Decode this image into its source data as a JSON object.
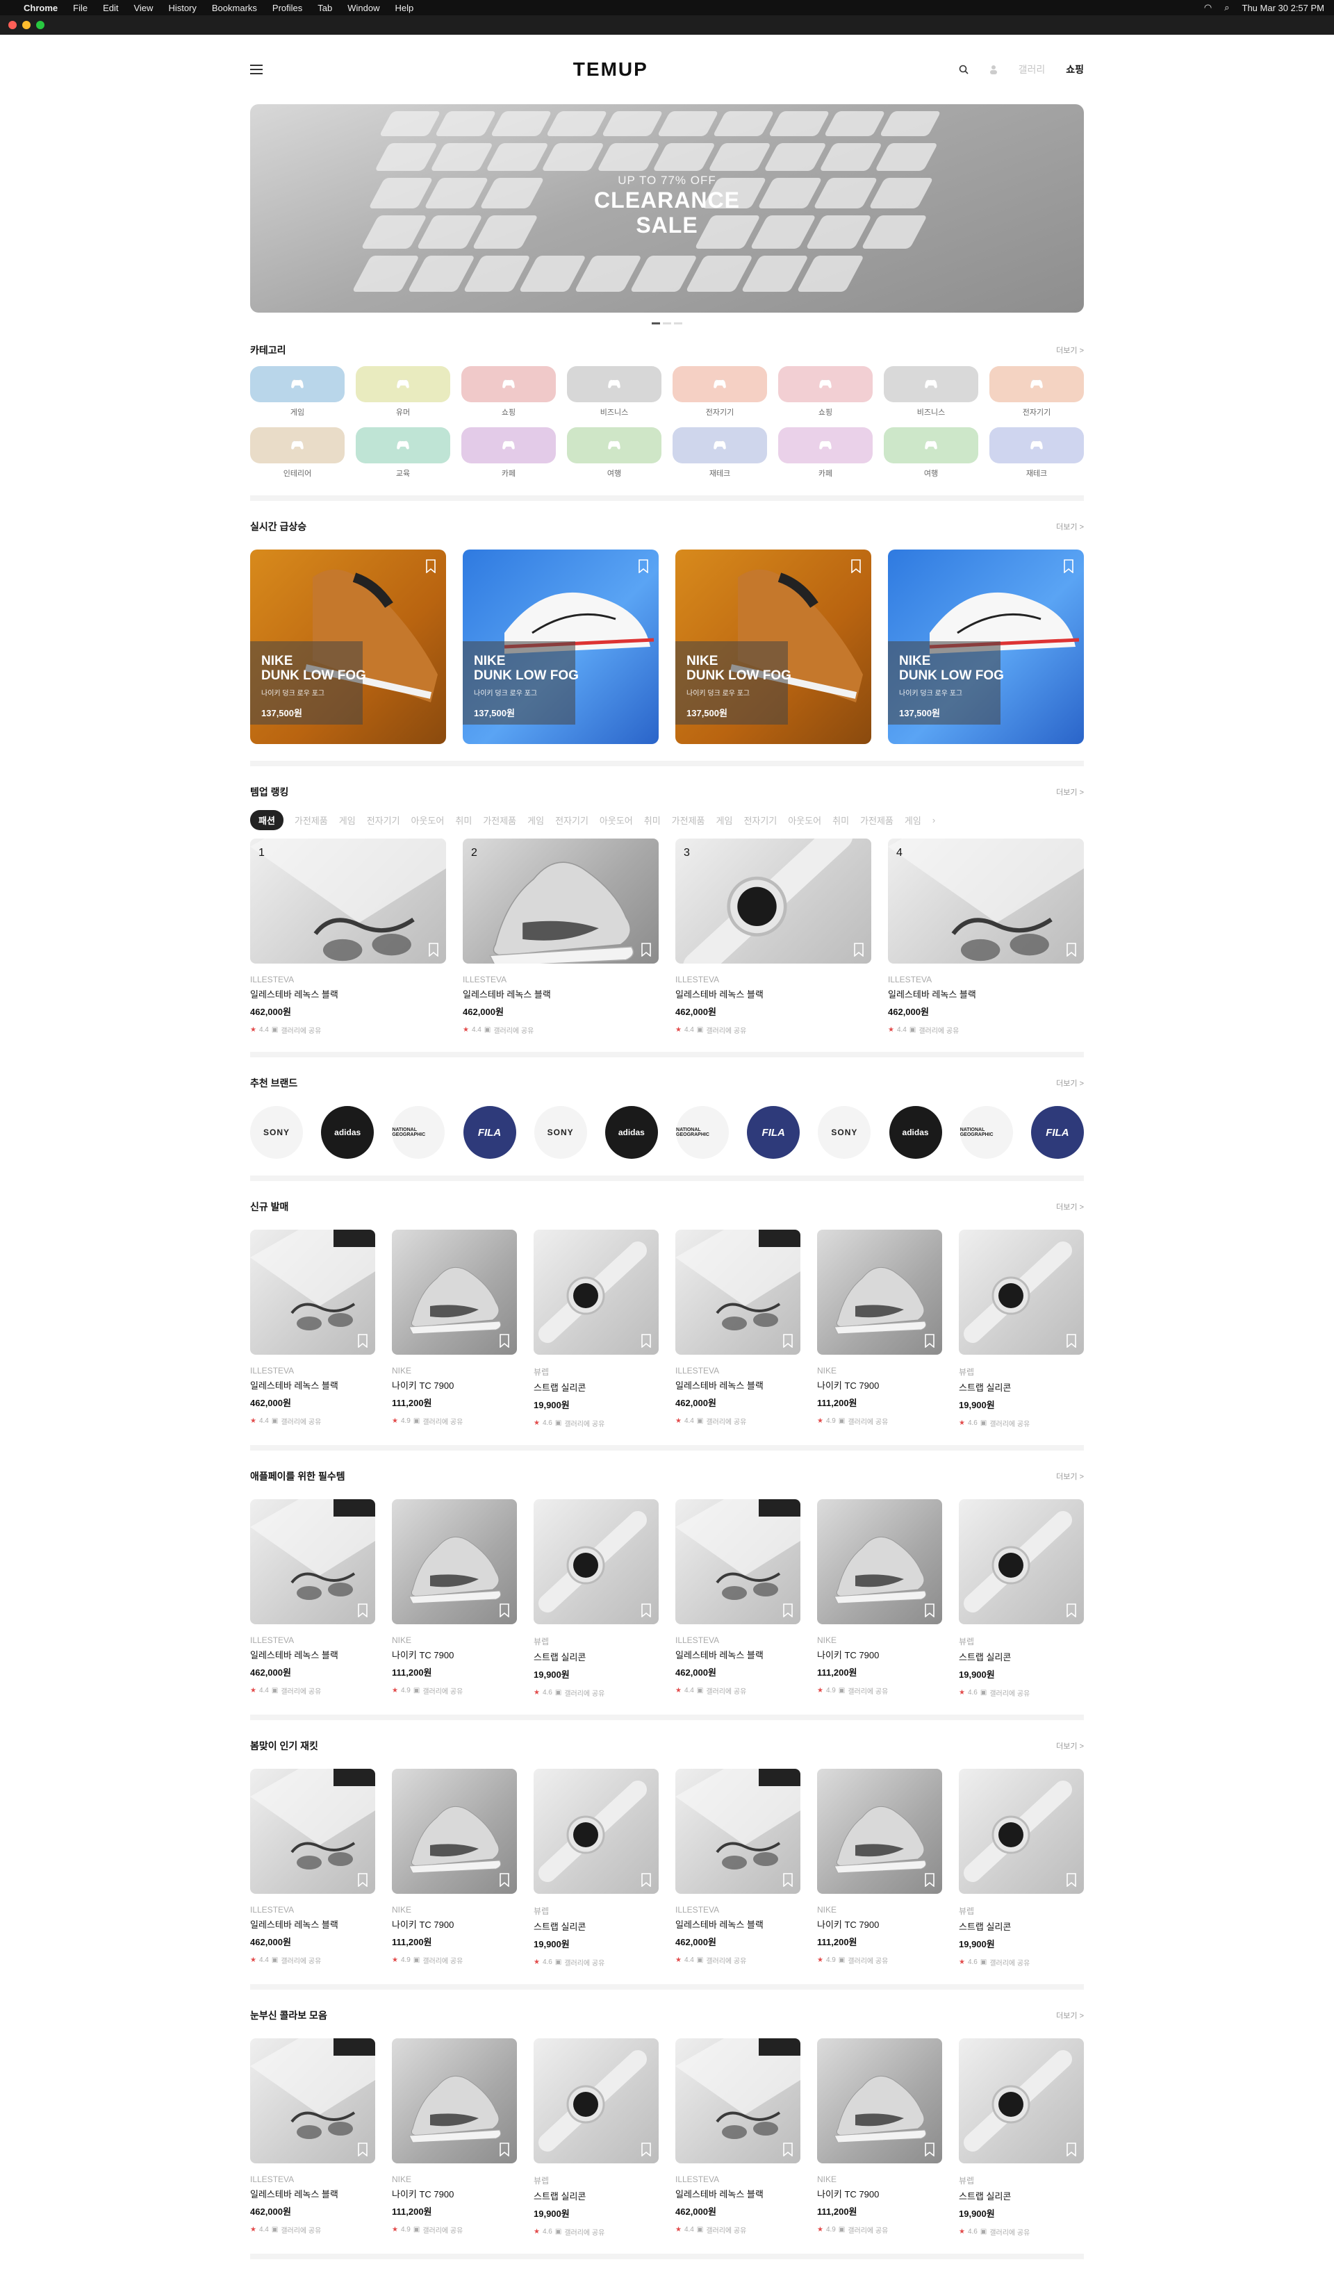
{
  "os_menu": {
    "app": "Chrome",
    "items": [
      "File",
      "Edit",
      "View",
      "History",
      "Bookmarks",
      "Profiles",
      "Tab",
      "Window",
      "Help"
    ],
    "clock": "Thu Mar 30  2:57 PM"
  },
  "header": {
    "logo": "TEMUP",
    "nav_dim": "갤러리",
    "nav_active": "쇼핑"
  },
  "banner": {
    "small": "UP TO 77% OFF",
    "line1": "CLEARANCE",
    "line2": "SALE"
  },
  "more_label": "더보기 >",
  "categories": {
    "title": "카테고리",
    "items": [
      {
        "label": "게임",
        "color": "#b9d6ea"
      },
      {
        "label": "유머",
        "color": "#e9ebbf"
      },
      {
        "label": "쇼핑",
        "color": "#f0c9c9"
      },
      {
        "label": "비즈니스",
        "color": "#d7d7d7"
      },
      {
        "label": "전자기기",
        "color": "#f5d0c4"
      },
      {
        "label": "쇼핑",
        "color": "#f2cfd3"
      },
      {
        "label": "비즈니스",
        "color": "#d9d9d9"
      },
      {
        "label": "전자기기",
        "color": "#f4d3c2"
      },
      {
        "label": "인테리어",
        "color": "#e9dcc8"
      },
      {
        "label": "교육",
        "color": "#bfe4d5"
      },
      {
        "label": "카페",
        "color": "#e3cbe8"
      },
      {
        "label": "여행",
        "color": "#cfe6c7"
      },
      {
        "label": "재테크",
        "color": "#cfd6ec"
      },
      {
        "label": "카페",
        "color": "#ead1e9"
      },
      {
        "label": "여행",
        "color": "#cde7c9"
      },
      {
        "label": "재테크",
        "color": "#cfd5ef"
      }
    ]
  },
  "trending": {
    "title": "실시간 급상승",
    "cards": [
      {
        "brand": "NIKE",
        "model": "DUNK LOW FOG",
        "sub": "나이키 덩크 로우 포그",
        "price": "137,500원",
        "theme": "brown"
      },
      {
        "brand": "NIKE",
        "model": "DUNK LOW FOG",
        "sub": "나이키 덩크 로우 포그",
        "price": "137,500원",
        "theme": "blue"
      },
      {
        "brand": "NIKE",
        "model": "DUNK LOW FOG",
        "sub": "나이키 덩크 로우 포그",
        "price": "137,500원",
        "theme": "brown"
      },
      {
        "brand": "NIKE",
        "model": "DUNK LOW FOG",
        "sub": "나이키 덩크 로우 포그",
        "price": "137,500원",
        "theme": "blue"
      }
    ]
  },
  "ranking": {
    "title": "템업 랭킹",
    "tabs": [
      "패션",
      "가전제품",
      "게임",
      "전자기기",
      "아웃도어",
      "취미",
      "가전제품",
      "게임",
      "전자기기",
      "아웃도어",
      "취미",
      "가전제품",
      "게임",
      "전자기기",
      "아웃도어",
      "취미",
      "가전제품",
      "게임"
    ],
    "items": [
      {
        "rank": "1",
        "brand": "ILLESTEVA",
        "name": "일레스테바 레녹스 블랙",
        "price": "462,000원",
        "rating": "4.4",
        "share": "갤러리에 공유",
        "img": "glasses"
      },
      {
        "rank": "2",
        "brand": "ILLESTEVA",
        "name": "일레스테바 레녹스 블랙",
        "price": "462,000원",
        "rating": "4.4",
        "share": "갤러리에 공유",
        "img": "shoe"
      },
      {
        "rank": "3",
        "brand": "ILLESTEVA",
        "name": "일레스테바 레녹스 블랙",
        "price": "462,000원",
        "rating": "4.4",
        "share": "갤러리에 공유",
        "img": "watch"
      },
      {
        "rank": "4",
        "brand": "ILLESTEVA",
        "name": "일레스테바 레녹스 블랙",
        "price": "462,000원",
        "rating": "4.4",
        "share": "갤러리에 공유",
        "img": "glasses"
      }
    ]
  },
  "brands": {
    "title": "추천 브랜드",
    "items": [
      {
        "name": "SONY",
        "style": "sony"
      },
      {
        "name": "adidas",
        "style": "adidas"
      },
      {
        "name": "NATIONAL GEOGRAPHIC",
        "style": "natgeo"
      },
      {
        "name": "FILA",
        "style": "fila"
      },
      {
        "name": "SONY",
        "style": "sony"
      },
      {
        "name": "adidas",
        "style": "adidas"
      },
      {
        "name": "NATIONAL GEOGRAPHIC",
        "style": "natgeo"
      },
      {
        "name": "FILA",
        "style": "fila"
      },
      {
        "name": "SONY",
        "style": "sony"
      },
      {
        "name": "adidas",
        "style": "adidas"
      },
      {
        "name": "NATIONAL GEOGRAPHIC",
        "style": "natgeo"
      },
      {
        "name": "FILA",
        "style": "fila"
      }
    ]
  },
  "product_sections": [
    {
      "title": "신규 발매"
    },
    {
      "title": "애플페이를 위한 필수템"
    },
    {
      "title": "봄맞이 인기 재킷"
    },
    {
      "title": "눈부신 콜라보 모음"
    }
  ],
  "products": [
    {
      "brand": "ILLESTEVA",
      "name": "일레스테바 레녹스 블랙",
      "price": "462,000원",
      "rating": "4.4",
      "share": "갤러리에 공유",
      "img": "glasses"
    },
    {
      "brand": "NIKE",
      "name": "나이키 TC 7900",
      "price": "111,200원",
      "rating": "4.9",
      "share": "갤러리에 공유",
      "img": "shoe"
    },
    {
      "brand": "뷰렙",
      "name": "스트랩 실리콘",
      "price": "19,900원",
      "rating": "4.6",
      "share": "갤러리에 공유",
      "img": "watch"
    },
    {
      "brand": "ILLESTEVA",
      "name": "일레스테바 레녹스 블랙",
      "price": "462,000원",
      "rating": "4.4",
      "share": "갤러리에 공유",
      "img": "glasses"
    },
    {
      "brand": "NIKE",
      "name": "나이키 TC 7900",
      "price": "111,200원",
      "rating": "4.9",
      "share": "갤러리에 공유",
      "img": "shoe"
    },
    {
      "brand": "뷰렙",
      "name": "스트랩 실리콘",
      "price": "19,900원",
      "rating": "4.6",
      "share": "갤러리에 공유",
      "img": "watch"
    }
  ]
}
